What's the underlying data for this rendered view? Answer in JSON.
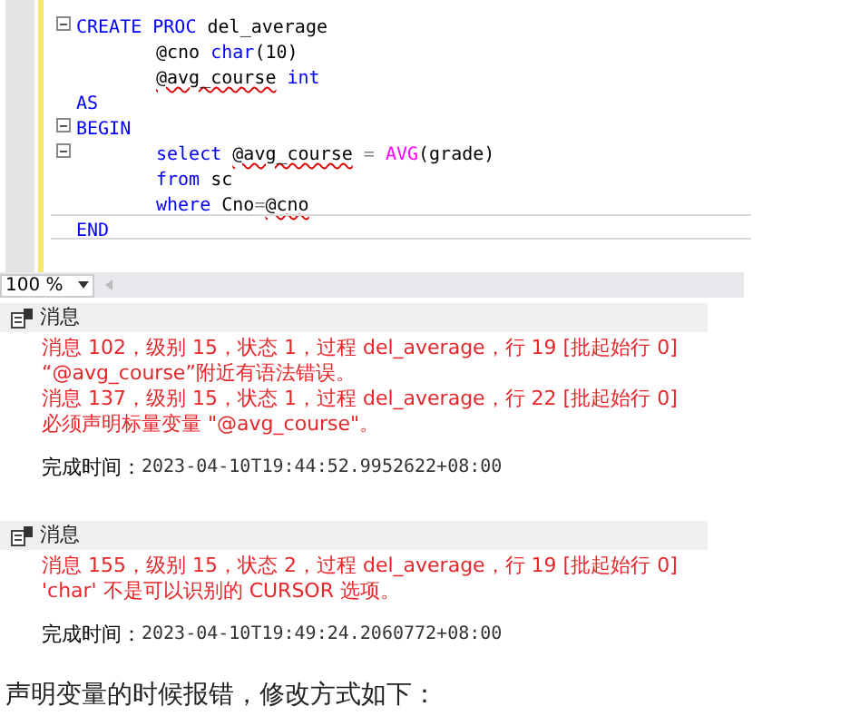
{
  "editor": {
    "lines": [
      {
        "fold": true,
        "indented": false,
        "current": false,
        "tokens": [
          {
            "text": "CREATE PROC",
            "kind": "keyword"
          },
          {
            "text": " del_average",
            "kind": "plain"
          }
        ]
      },
      {
        "fold": false,
        "indented": true,
        "current": false,
        "tokens": [
          {
            "text": "@cno ",
            "kind": "plain"
          },
          {
            "text": "char",
            "kind": "keyword"
          },
          {
            "text": "(10)",
            "kind": "plain"
          }
        ]
      },
      {
        "fold": false,
        "indented": true,
        "current": false,
        "tokens": [
          {
            "text": "@avg_course",
            "kind": "error"
          },
          {
            "text": " int",
            "kind": "keyword"
          }
        ]
      },
      {
        "fold": false,
        "indented": false,
        "current": false,
        "tokens": [
          {
            "text": "AS",
            "kind": "keyword"
          }
        ]
      },
      {
        "fold": true,
        "indented": false,
        "current": false,
        "tokens": [
          {
            "text": "BEGIN",
            "kind": "keyword"
          }
        ]
      },
      {
        "fold": true,
        "indented": true,
        "current": false,
        "tokens": [
          {
            "text": "select ",
            "kind": "keyword"
          },
          {
            "text": "@avg_course",
            "kind": "error"
          },
          {
            "text": " = ",
            "kind": "operator"
          },
          {
            "text": "AVG",
            "kind": "function"
          },
          {
            "text": "(grade)",
            "kind": "plain"
          }
        ]
      },
      {
        "fold": false,
        "indented": true,
        "current": false,
        "tokens": [
          {
            "text": "from",
            "kind": "keyword"
          },
          {
            "text": " sc",
            "kind": "plain"
          }
        ]
      },
      {
        "fold": false,
        "indented": true,
        "current": false,
        "tokens": [
          {
            "text": "where",
            "kind": "keyword"
          },
          {
            "text": " Cno",
            "kind": "plain"
          },
          {
            "text": "=",
            "kind": "operator"
          },
          {
            "text": "@cno",
            "kind": "error"
          }
        ]
      },
      {
        "fold": false,
        "indented": false,
        "current": true,
        "tokens": [
          {
            "text": "END",
            "kind": "keyword"
          }
        ]
      }
    ]
  },
  "zoom": {
    "value": "100 %"
  },
  "results": [
    {
      "header": "消息",
      "errors": [
        "消息 102，级别 15，状态 1，过程 del_average，行 19 [批起始行 0]",
        "“@avg_course”附近有语法错误。",
        "消息 137，级别 15，状态 1，过程 del_average，行 22 [批起始行 0]",
        "必须声明标量变量 \"@avg_course\"。"
      ],
      "completion_label": "完成时间：",
      "completion_time": "2023-04-10T19:44:52.9952622+08:00"
    },
    {
      "header": "消息",
      "errors": [
        "消息 155，级别 15，状态 2，过程 del_average，行 19 [批起始行 0]",
        "'char' 不是可以识别的 CURSOR 选项。"
      ],
      "completion_label": "完成时间：",
      "completion_time": "2023-04-10T19:49:24.2060772+08:00"
    }
  ],
  "caption": "声明变量的时候报错，修改方式如下："
}
